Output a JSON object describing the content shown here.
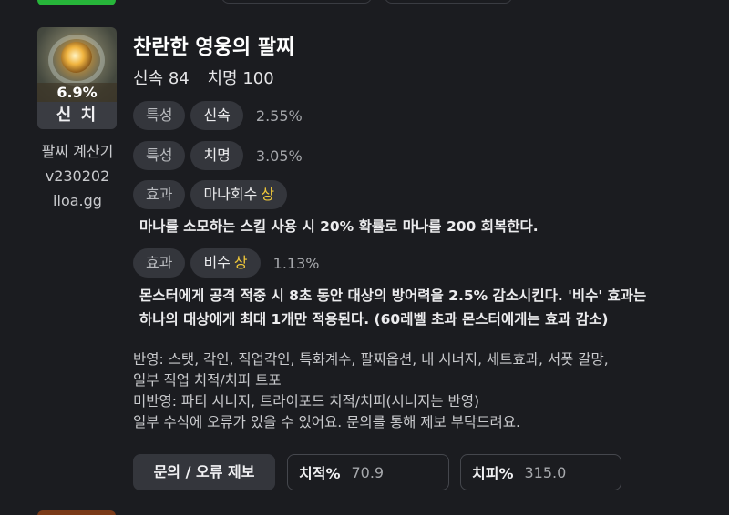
{
  "item": {
    "name": "찬란한 영웅의 팔찌",
    "percent": "6.9%",
    "label": "신 치",
    "stats": [
      "신속 84",
      "치명 100"
    ]
  },
  "calculator": {
    "line1": "팔찌 계산기",
    "line2": "v230202",
    "line3": "iloa.gg"
  },
  "effects": [
    {
      "category": "특성",
      "name": "신속",
      "grade": "",
      "value": "2.55%"
    },
    {
      "category": "특성",
      "name": "치명",
      "grade": "",
      "value": "3.05%"
    },
    {
      "category": "효과",
      "name": "마나회수",
      "grade": "상",
      "value": ""
    },
    {
      "category": "효과",
      "name": "비수",
      "grade": "상",
      "value": "1.13%"
    }
  ],
  "descriptions": {
    "mana": "마나를 소모하는 스킬 사용 시 20% 확률로 마나를 200 회복한다.",
    "bisu_line1": "몬스터에게 공격 적중 시 8초 동안 대상의 방어력을 2.5% 감소시킨다. '비수' 효과는",
    "bisu_line2": "하나의 대상에게 최대 1개만 적용된다. (60레벨 초과 몬스터에게는 효과 감소)"
  },
  "notes": {
    "line1": "반영: 스탯, 각인, 직업각인, 특화계수, 팔찌옵션, 내 시너지, 세트효과, 서폿 갈망,",
    "line2": "일부 직업 치적/치피 트포",
    "line3": "미반영: 파티 시너지, 트라이포드 치적/치피(시너지는 반영)",
    "line4": "일부 수식에 오류가 있을 수 있어요. 문의를 통해 제보 부탁드려요."
  },
  "actions": {
    "report_label": "문의 / 오류 제보",
    "crit_rate_label": "치적%",
    "crit_rate_value": "70.9",
    "crit_dmg_label": "치피%",
    "crit_dmg_value": "315.0"
  },
  "colors": {
    "background": "#1b1c20",
    "tag_bg": "#34363c",
    "grade_gold": "#f0c83a",
    "accent_green": "#27b53a"
  }
}
